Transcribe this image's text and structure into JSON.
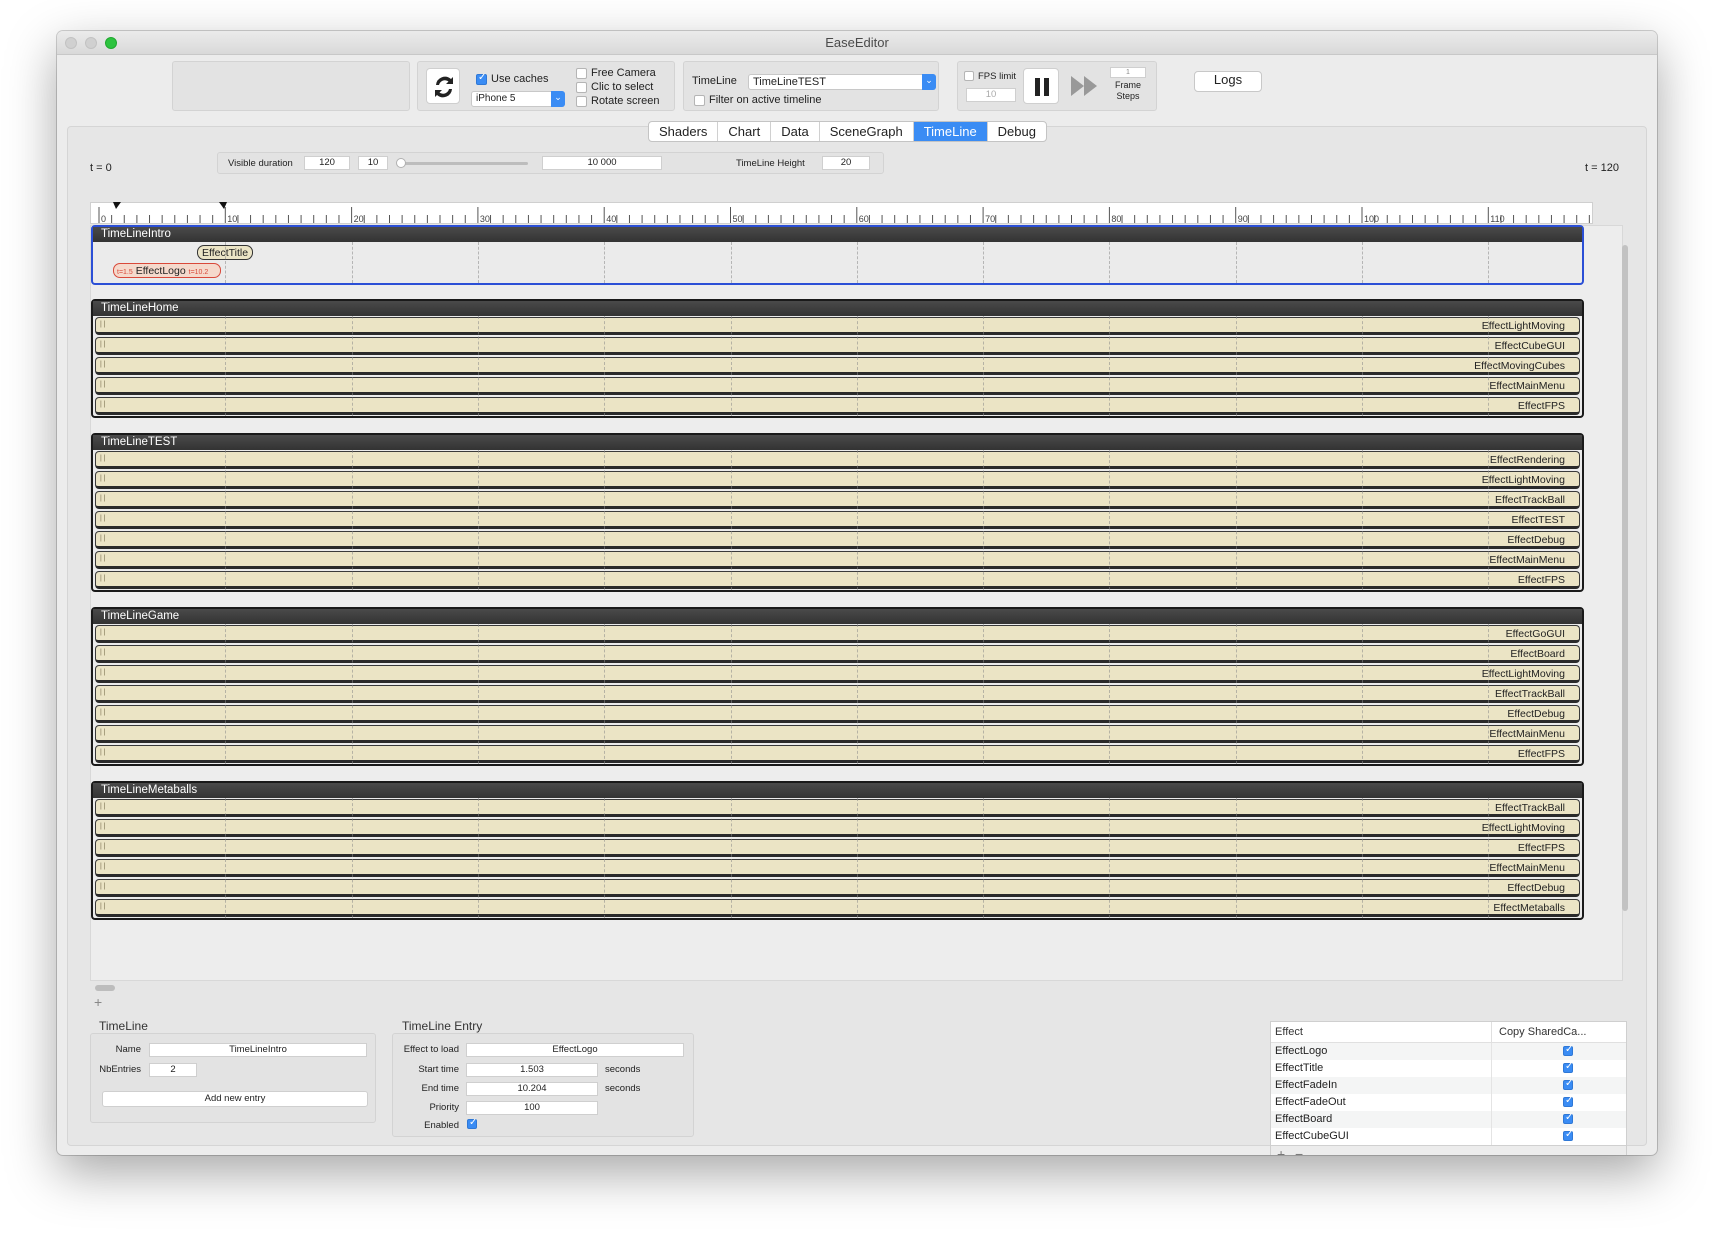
{
  "window": {
    "title": "EaseEditor"
  },
  "toolbar": {
    "use_caches": "Use caches",
    "device": "iPhone 5",
    "free_camera": "Free Camera",
    "clic_to_select": "Clic to select",
    "rotate_screen": "Rotate screen",
    "timeline_label": "TimeLine",
    "timeline_value": "TimeLineTEST",
    "filter_active": "Filter on active timeline",
    "fps_limit": "FPS limit",
    "fps_value": "10",
    "frame_steps_value": "1",
    "frame_steps": "Frame Steps",
    "logs": "Logs"
  },
  "tabs": [
    "Shaders",
    "Chart",
    "Data",
    "SceneGraph",
    "TimeLine",
    "Debug"
  ],
  "active_tab": "TimeLine",
  "controls": {
    "t_start": "t = 0",
    "t_end": "t = 120",
    "visible_duration_label": "Visible duration",
    "visible_duration": "120",
    "step": "10",
    "max": "10 000",
    "timeline_height_label": "TimeLine Height",
    "timeline_height": "20"
  },
  "ruler_ticks": [
    "0",
    "10",
    "20",
    "30",
    "40",
    "50",
    "60",
    "70",
    "80",
    "90",
    "100",
    "110",
    "12"
  ],
  "intro": {
    "name": "TimeLineIntro",
    "title_pill": "EffectTitle",
    "logo_pill": "EffectLogo",
    "logo_start": "t=1.5",
    "logo_end": "t=10.2"
  },
  "groups": [
    {
      "name": "TimeLineHome",
      "effects": [
        "EffectLightMoving",
        "EffectCubeGUI",
        "EffectMovingCubes",
        "EffectMainMenu",
        "EffectFPS"
      ]
    },
    {
      "name": "TimeLineTEST",
      "effects": [
        "EffectRendering",
        "EffectLightMoving",
        "EffectTrackBall",
        "EffectTEST",
        "EffectDebug",
        "EffectMainMenu",
        "EffectFPS"
      ]
    },
    {
      "name": "TimeLineGame",
      "effects": [
        "EffectGoGUI",
        "EffectBoard",
        "EffectLightMoving",
        "EffectTrackBall",
        "EffectDebug",
        "EffectMainMenu",
        "EffectFPS"
      ]
    },
    {
      "name": "TimeLineMetaballs",
      "effects": [
        "EffectTrackBall",
        "EffectLightMoving",
        "EffectFPS",
        "EffectMainMenu",
        "EffectDebug",
        "EffectMetaballs"
      ]
    }
  ],
  "timeline_panel": {
    "title": "TimeLine",
    "name_label": "Name",
    "name_value": "TimeLineIntro",
    "nbentries_label": "NbEntries",
    "nbentries_value": "2",
    "add_entry": "Add new entry"
  },
  "entry_panel": {
    "title": "TimeLine Entry",
    "effect_label": "Effect to load",
    "effect_value": "EffectLogo",
    "start_label": "Start time",
    "start_value": "1.503",
    "end_label": "End time",
    "end_value": "10.204",
    "seconds": "seconds",
    "priority_label": "Priority",
    "priority_value": "100",
    "enabled_label": "Enabled"
  },
  "effect_table": {
    "col_effect": "Effect",
    "col_copy": "Copy SharedCa...",
    "rows": [
      "EffectLogo",
      "EffectTitle",
      "EffectFadeIn",
      "EffectFadeOut",
      "EffectBoard",
      "EffectCubeGUI"
    ]
  },
  "colors": {
    "accent": "#3a8cf4",
    "effect_bar": "#ebe4c5",
    "intro_border": "#2b4fd6"
  }
}
